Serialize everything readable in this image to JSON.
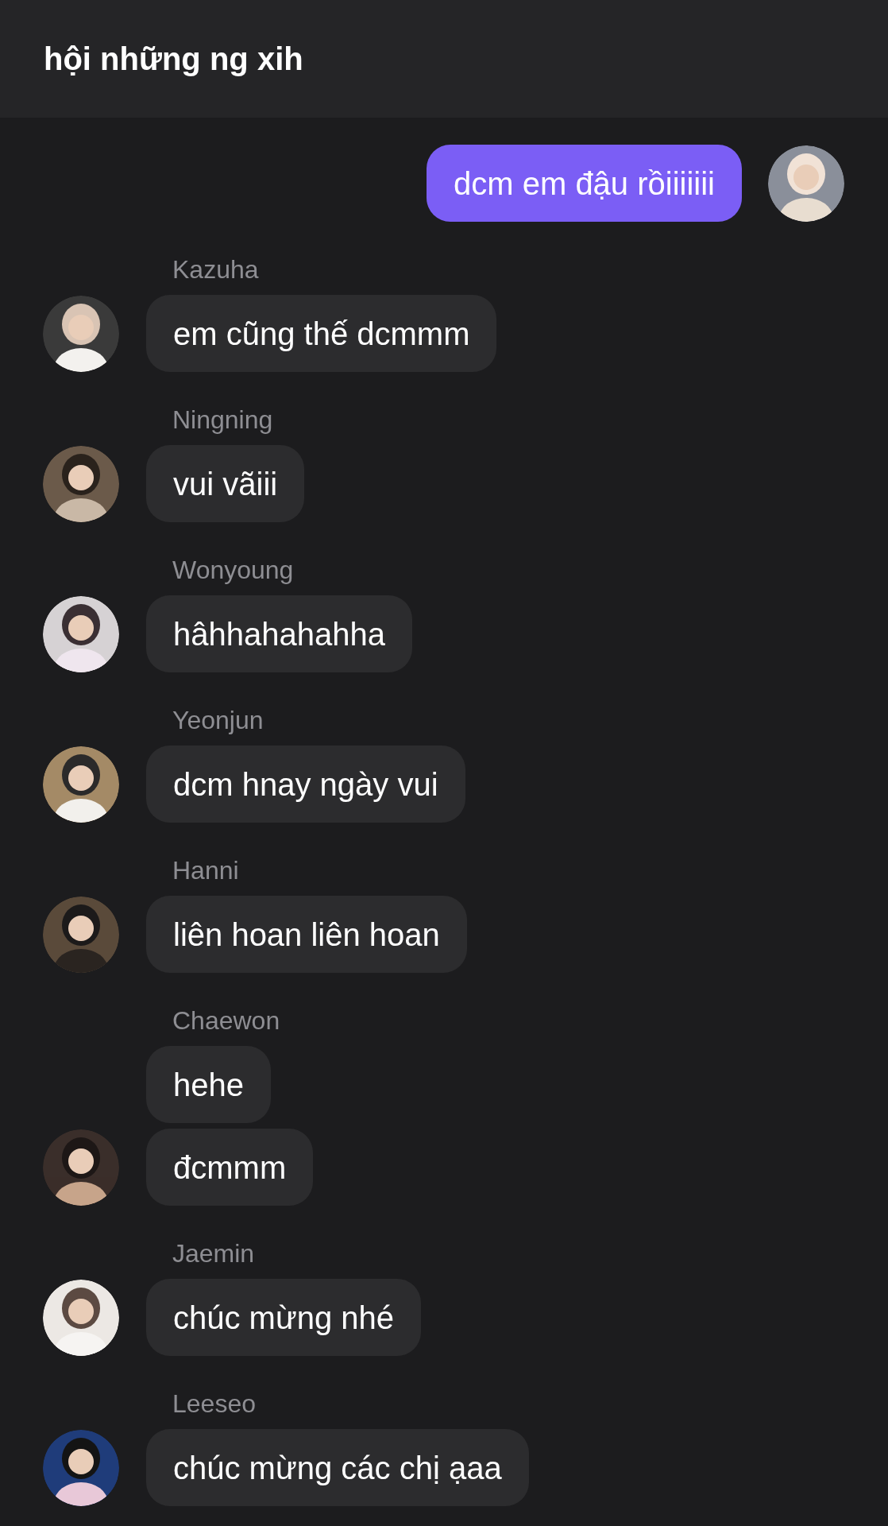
{
  "header": {
    "title": "hội những ng xih"
  },
  "messages": [
    {
      "kind": "outgoing",
      "texts": [
        "dcm em đậu rồiiiiiii"
      ]
    },
    {
      "kind": "incoming",
      "sender": "Kazuha",
      "texts": [
        "em cũng thế dcmmm"
      ]
    },
    {
      "kind": "incoming",
      "sender": "Ningning",
      "texts": [
        "vui vãiii"
      ]
    },
    {
      "kind": "incoming",
      "sender": "Wonyoung",
      "texts": [
        "hâhhahahahha"
      ]
    },
    {
      "kind": "incoming",
      "sender": "Yeonjun",
      "texts": [
        "dcm hnay ngày vui"
      ]
    },
    {
      "kind": "incoming",
      "sender": "Hanni",
      "texts": [
        "liên hoan liên hoan"
      ]
    },
    {
      "kind": "incoming",
      "sender": "Chaewon",
      "texts": [
        "hehe",
        "đcmmm"
      ]
    },
    {
      "kind": "incoming",
      "sender": "Jaemin",
      "texts": [
        "chúc mừng nhé"
      ]
    },
    {
      "kind": "incoming",
      "sender": "Leeseo",
      "texts": [
        "chúc mừng các chị ạaa"
      ]
    }
  ]
}
